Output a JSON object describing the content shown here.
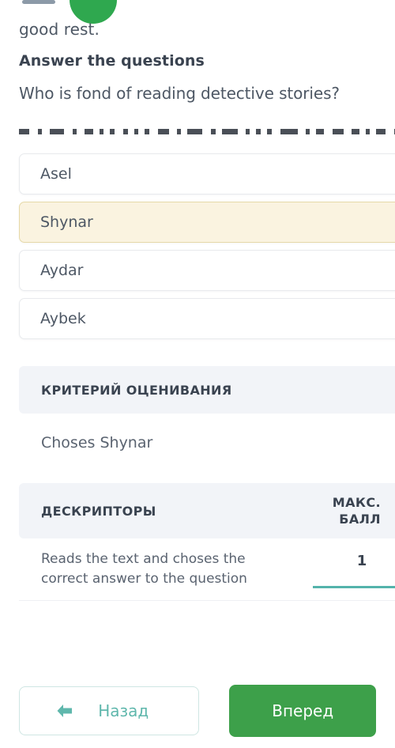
{
  "decor": {
    "bar_color": "#8c9aa8",
    "circle_color": "#2fa84f"
  },
  "lesson": {
    "passage_tail": "good rest.",
    "heading": "Answer the questions",
    "question": "Who is fond of reading detective stories?",
    "redacted_note": "obscured-text-line"
  },
  "options": [
    {
      "label": "Asel",
      "selected": false
    },
    {
      "label": "Shynar",
      "selected": true
    },
    {
      "label": "Aydar",
      "selected": false
    },
    {
      "label": "Aybek",
      "selected": false
    }
  ],
  "criteria": {
    "header": "КРИТЕРИЙ ОЦЕНИВАНИЯ",
    "body": "Choses Shynar"
  },
  "descriptors": {
    "col_descriptors": "ДЕСКРИПТОРЫ",
    "col_max_line1": "МАКС.",
    "col_max_line2": "БАЛЛ",
    "rows": [
      {
        "text": "Reads the text and choses the correct answer to the question",
        "score": "1"
      }
    ]
  },
  "footer": {
    "back_label": "Назад",
    "forward_label": "Вперед",
    "back_accent": "#5fb7ac",
    "forward_bg": "#3da04a"
  }
}
